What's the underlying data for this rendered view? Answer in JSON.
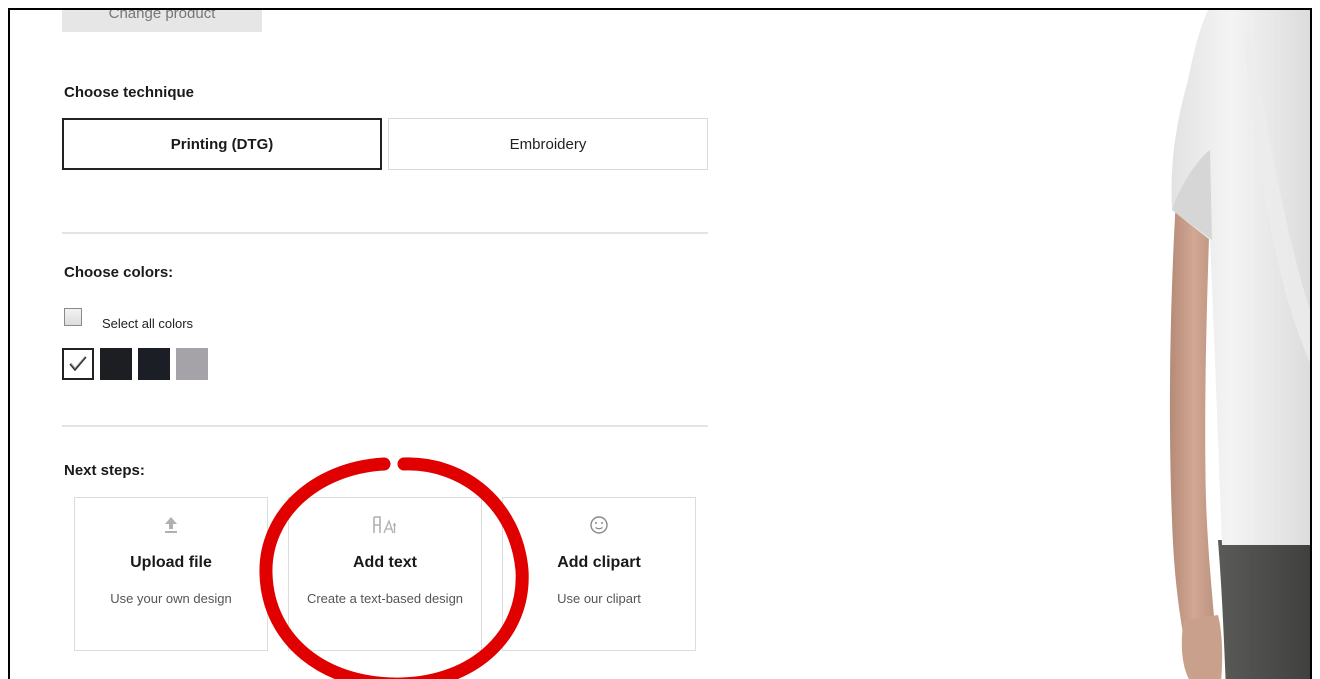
{
  "product": {
    "change_label": "Change product"
  },
  "technique": {
    "title": "Choose technique",
    "options": [
      {
        "label": "Printing (DTG)",
        "selected": true
      },
      {
        "label": "Embroidery",
        "selected": false
      }
    ]
  },
  "colors": {
    "title": "Choose colors:",
    "select_all_label": "Select all colors",
    "select_all_checked": false,
    "swatches": [
      {
        "color": "#ffffff",
        "selected": true
      },
      {
        "color": "#1c1e22",
        "selected": false
      },
      {
        "color": "#1c1e26",
        "selected": false
      },
      {
        "color": "#a6a3a8",
        "selected": false
      }
    ]
  },
  "next_steps": {
    "title": "Next steps:",
    "cards": [
      {
        "icon": "upload-icon",
        "title": "Upload file",
        "desc": "Use your own design"
      },
      {
        "icon": "text-icon",
        "title": "Add text",
        "desc": "Create a text-based design"
      },
      {
        "icon": "smiley-icon",
        "title": "Add clipart",
        "desc": "Use our clipart"
      }
    ]
  },
  "annotation": {
    "highlight_color": "#e00000"
  }
}
